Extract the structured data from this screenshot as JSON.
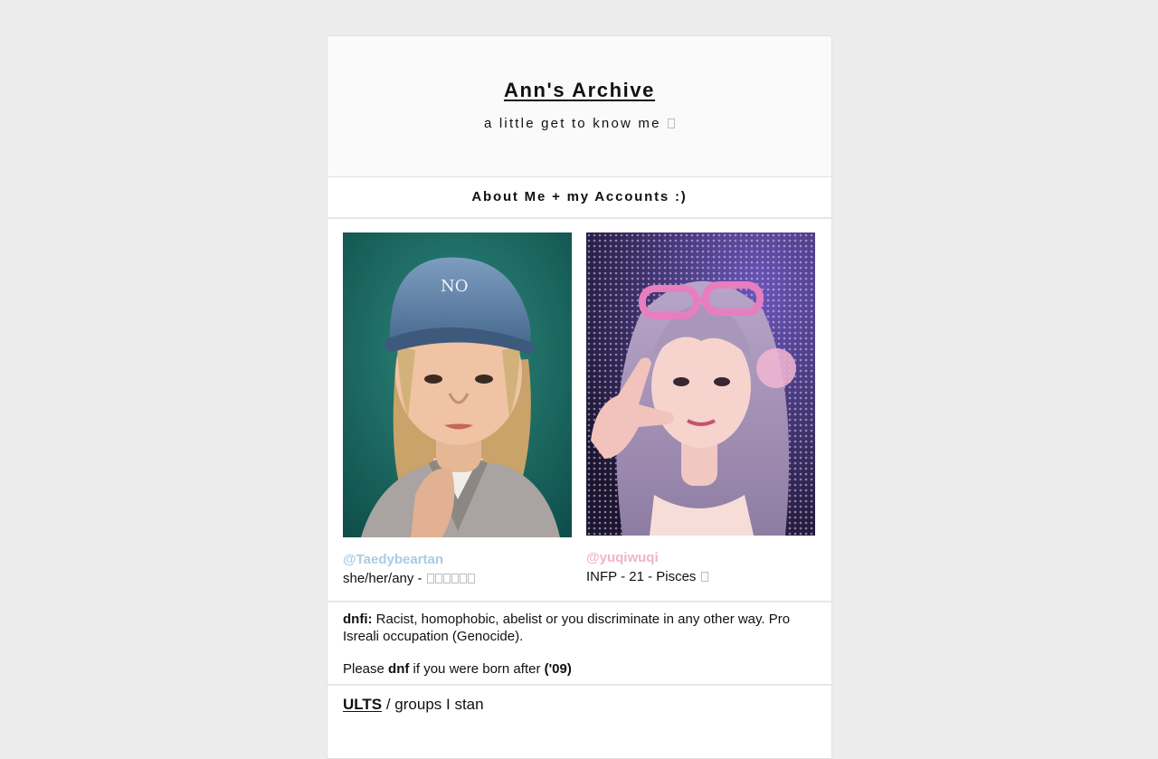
{
  "header": {
    "title": "Ann's Archive",
    "subtitle": "a little get to know me"
  },
  "section": {
    "about_heading": "About Me + my Accounts :)"
  },
  "accounts": [
    {
      "handle": "@Taedybeartan",
      "info": "she/her/any -",
      "handle_color": "#a9cbe3",
      "photo": "photo of person in blue denim cap"
    },
    {
      "handle": "@yuqiwuqi",
      "info": "INFP - 21 - Pisces",
      "handle_color": "#f2b3c6",
      "photo": "photo of person with pink goggles"
    }
  ],
  "dnfi": {
    "label": "dnfi:",
    "text": "Racist, homophobic, abelist or you discriminate in any other way. Pro Isreali occupation (Genocide).",
    "please_prefix": "Please",
    "please_bold": "dnf",
    "please_mid": "if you were born after",
    "please_year": "('09)"
  },
  "ults": {
    "link": "ULTS",
    "rest": "/ groups I stan"
  }
}
